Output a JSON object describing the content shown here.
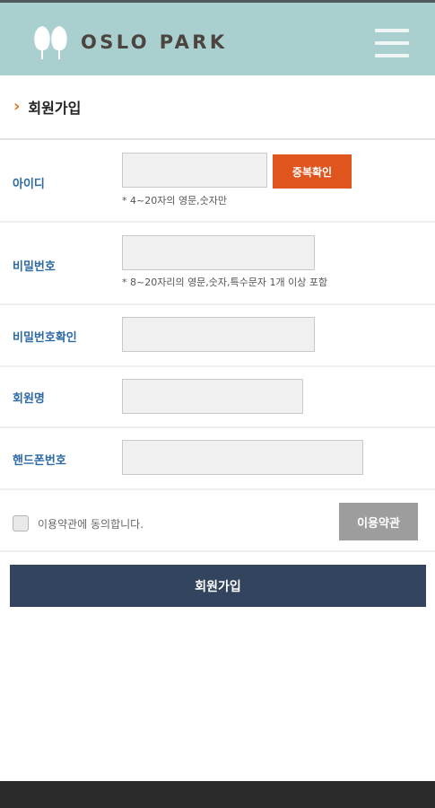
{
  "header": {
    "logo_text": "OSLO PARK"
  },
  "page_title": "회원가입",
  "form": {
    "id_label": "아이디",
    "id_check_button": "중복확인",
    "id_hint": "* 4~20자의 영문,숫자만",
    "password_label": "비밀번호",
    "password_hint": "* 8~20자리의 영문,숫자,특수문자 1개 이상 포함",
    "password_confirm_label": "비밀번호확인",
    "name_label": "회원명",
    "phone_label": "핸드폰번호"
  },
  "terms": {
    "agree_text": "이용약관에 동의합니다.",
    "button_label": "이용약관"
  },
  "submit_label": "회원가입",
  "colors": {
    "header": "#a9cfcf",
    "label_blue": "#2d6aa5",
    "check_button": "#e0541e",
    "terms_button": "#9d9d9d",
    "submit_button": "#33445e"
  }
}
